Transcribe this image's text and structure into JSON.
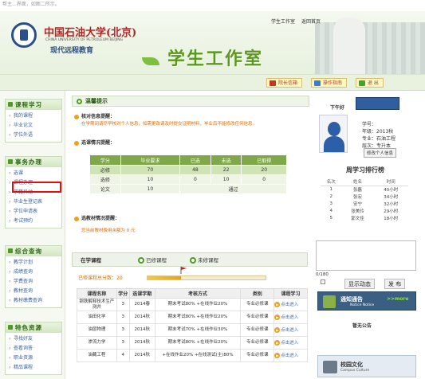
{
  "header": {
    "caption": "帮主...界面，如图二所示。",
    "links": [
      "学生工作室",
      "返回首页"
    ],
    "school_cn": "中国石油大学(北京)",
    "school_en": "CHINA UNIVERSITY OF PETROLEUM BEIJING",
    "school_sub": "现代远程教育",
    "studio_title": "学生工作室"
  },
  "navbar": {
    "buttons": [
      "院长信箱",
      "操作指南",
      "退 出"
    ]
  },
  "sidebar": {
    "sections": [
      {
        "title": "课程学习",
        "items": [
          "我的课程",
          "毕业论文",
          "学位外语"
        ]
      },
      {
        "title": "事务办理",
        "items": [
          "选课",
          "课程办理",
          "学籍异动",
          "毕业生登记表",
          "学位申请表",
          "考试预约"
        ]
      },
      {
        "title": "综合查询",
        "items": [
          "教学计划",
          "成绩查询",
          "学费查询",
          "教材查询",
          "教材缴费查询"
        ]
      },
      {
        "title": "特色资源",
        "items": [
          "寻找好友",
          "查看询答",
          "职业资源",
          "精品课程"
        ]
      }
    ]
  },
  "main": {
    "warm_tip_title": "温馨提示",
    "info_check_title": "核对信息提醒：",
    "info_check_note": "在学期间请尽早核对个人信息，如需更改请及时提交证明材料，毕业后不能修改任何信息。",
    "course_status_title": "选课情况提醒：",
    "course_table": {
      "headers": [
        "学分",
        "毕业要求",
        "已选",
        "未选",
        "已取得"
      ],
      "rows": [
        [
          "必修",
          "70",
          "48",
          "22",
          "20"
        ],
        [
          "选修",
          "10",
          "0",
          "10",
          "0"
        ],
        [
          "论文",
          "10",
          "",
          "",
          ""
        ]
      ],
      "merged_note": "通过"
    },
    "textbook_title": "选教材情况提醒：",
    "textbook_note": "您当前教材费用余额为 0 元",
    "tabs": [
      "在学课程",
      "已修课程",
      "未修课程"
    ],
    "credit_label": "已修课程总分数：20",
    "progress_fraction": 0.286,
    "course_list": {
      "headers": [
        "课程名称",
        "学分",
        "选课学期",
        "考核方式",
        "类别",
        "课程学习"
      ],
      "rows": [
        [
          "钢铁解释技术生产测井",
          "3",
          "2014春",
          "期末考试80% +在线作业20%",
          "专业必修课",
          "点击进入"
        ],
        [
          "油田化学",
          "3",
          "2014秋",
          "期末考试80% +在线作业20%",
          "专业必修课",
          "点击进入"
        ],
        [
          "油层物理",
          "3",
          "2014秋",
          "期末考试70% +在线作业30%",
          "专业必修课",
          "点击进入"
        ],
        [
          "渗流力学",
          "3",
          "2014秋",
          "期末考试80% +在线作业20%",
          "专业必修课",
          "点击进入"
        ],
        [
          "油藏工程",
          "4",
          "2014秋",
          "+在线作业20% +在线测试(主)80%",
          "专业必修课",
          "点击进入"
        ]
      ]
    }
  },
  "right": {
    "greeting": "下午好",
    "info": [
      "学号：",
      "年级：2013秋",
      "专业：石油工程",
      "层次：专升本"
    ],
    "edit_button": "修改个人信息",
    "rank_title": "周学习排行榜",
    "rank_headers": [
      "名次",
      "姓名",
      "时间"
    ],
    "rank_rows": [
      [
        "1",
        "张磊",
        "40小时"
      ],
      [
        "2",
        "张宏",
        "34小时"
      ],
      [
        "3",
        "安宁",
        "32小时"
      ],
      [
        "4",
        "张美玲",
        "29小时"
      ],
      [
        "5",
        "郭文佳",
        "18小时"
      ]
    ],
    "char_count": "0/180",
    "show_button": "显示动态",
    "publish_button": "发 布",
    "notice_title": "通知通告",
    "notice_en": "Notice Notice",
    "notice_more": ">>more",
    "no_notice": "暂无公告",
    "culture_title": "校园文化",
    "culture_en": "Campus Culture"
  }
}
